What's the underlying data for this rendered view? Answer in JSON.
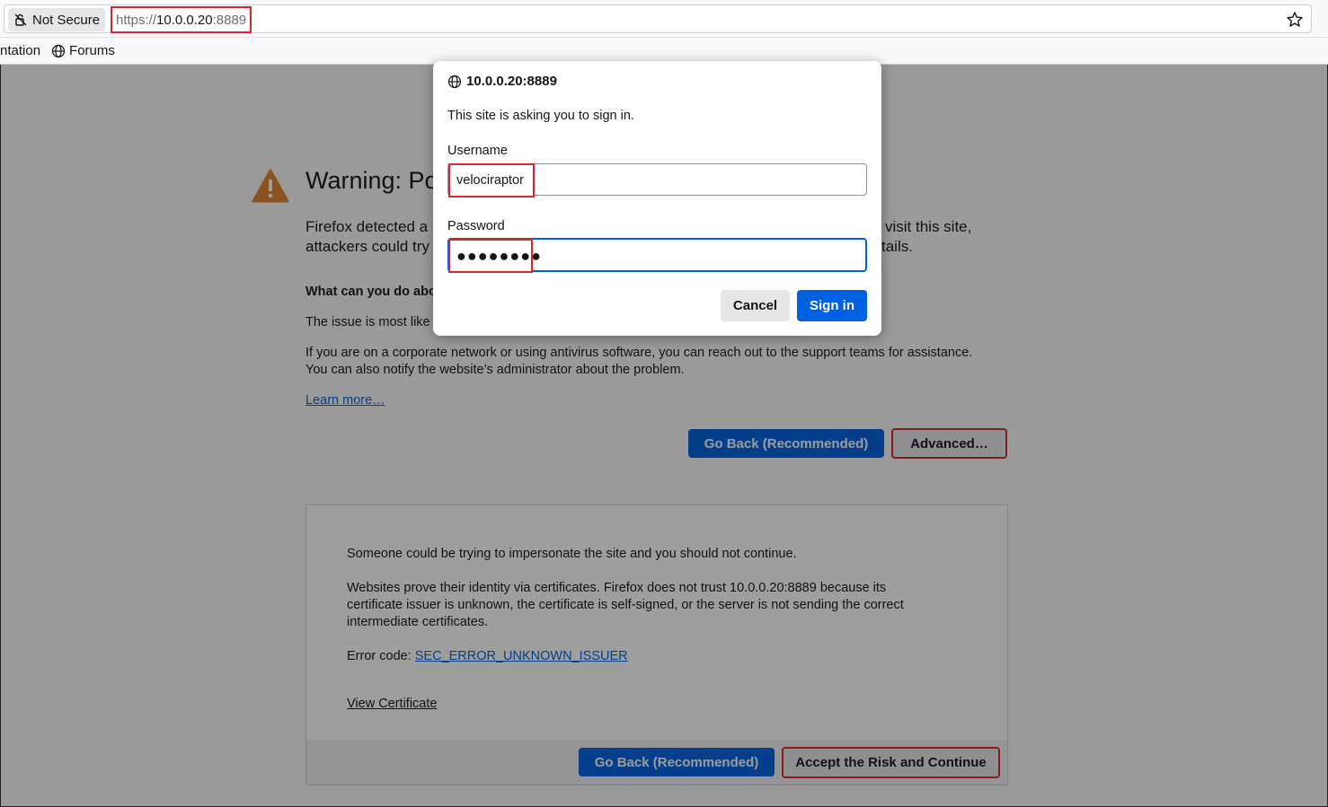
{
  "browser": {
    "security_label": "Not Secure",
    "url_scheme": "https://",
    "url_host": "10.0.0.20",
    "url_port": ":8889",
    "bookmarks": [
      {
        "label": "ntation",
        "icon": "none"
      },
      {
        "label": "Forums",
        "icon": "globe-icon"
      }
    ]
  },
  "page": {
    "title": "Warning: Po",
    "intro_line1_left": "Firefox detected a",
    "intro_line1_right": "visit this site,",
    "intro_line2_left": "attackers could try",
    "intro_line2_right": "tails.",
    "what_heading": "What can you do abo",
    "issue_text": "The issue is most like",
    "corporate_line1": "If you are on a corporate network or using antivirus software, you can reach out to the support teams for assistance.",
    "corporate_line2": "You can also notify the website’s administrator about the problem.",
    "learn_more": "Learn more…",
    "go_back_label": "Go Back (Recommended)",
    "advanced_label": "Advanced…"
  },
  "advanced": {
    "impersonate_text": "Someone could be trying to impersonate the site and you should not continue.",
    "cert_line1": "Websites prove their identity via certificates. Firefox does not trust 10.0.0.20:8889 because its",
    "cert_line2": "certificate issuer is unknown, the certificate is self-signed, or the server is not sending the correct",
    "cert_line3": "intermediate certificates.",
    "error_code_label": "Error code: ",
    "error_code": "SEC_ERROR_UNKNOWN_ISSUER",
    "view_certificate": "View Certificate",
    "go_back_label": "Go Back (Recommended)",
    "accept_label": "Accept the Risk and Continue"
  },
  "dialog": {
    "host": "10.0.0.20:8889",
    "message": "This site is asking you to sign in.",
    "username_label": "Username",
    "username_value": "velociraptor",
    "password_label": "Password",
    "password_mask": "●●●●●●●●",
    "cancel_label": "Cancel",
    "signin_label": "Sign in"
  },
  "colors": {
    "accent": "#0061e0",
    "highlight": "#d9262b",
    "warning": "#e2822f"
  }
}
